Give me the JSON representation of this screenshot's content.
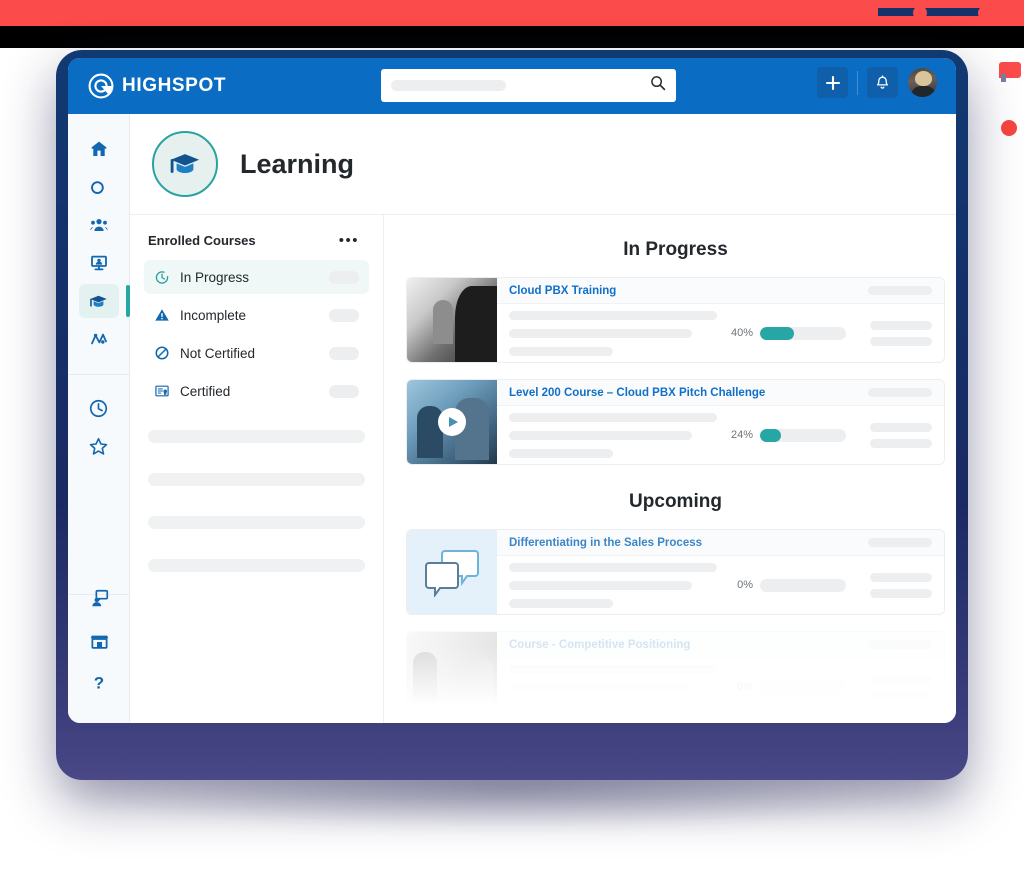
{
  "topnav": {
    "brand": "HIGHSPOT",
    "brand_logo_name": "highspot-logo",
    "search_placeholder": "",
    "search_value": "",
    "add_label": "+",
    "accent_blue": "#0b6cc4"
  },
  "page": {
    "title": "Learning",
    "badge_icon": "graduation-cap-icon",
    "accent_teal": "#26a7a5"
  },
  "rail": {
    "items": [
      {
        "name": "home",
        "icon": "home-icon"
      },
      {
        "name": "spots",
        "icon": "spots-icon"
      },
      {
        "name": "people",
        "icon": "people-icon"
      },
      {
        "name": "pitch",
        "icon": "presentation-icon"
      },
      {
        "name": "learning",
        "icon": "graduation-cap-icon",
        "active": true
      },
      {
        "name": "analytics",
        "icon": "analytics-icon"
      },
      {
        "name": "recent",
        "icon": "clock-icon"
      },
      {
        "name": "bookmarks",
        "icon": "star-icon"
      }
    ],
    "bottom_items": [
      {
        "name": "feedback",
        "icon": "feedback-icon"
      },
      {
        "name": "marketplace",
        "icon": "store-icon"
      },
      {
        "name": "help",
        "icon": "question-mark-icon"
      }
    ]
  },
  "left_pane": {
    "title": "Enrolled Courses",
    "menu_label": "•••",
    "filters": [
      {
        "label": "In Progress",
        "icon": "clock-progress-icon",
        "active": true
      },
      {
        "label": "Incomplete",
        "icon": "warning-triangle-icon",
        "active": false
      },
      {
        "label": "Not Certified",
        "icon": "no-entry-icon",
        "active": false
      },
      {
        "label": "Certified",
        "icon": "certificate-icon",
        "active": false
      }
    ]
  },
  "sections": [
    {
      "title": "In Progress",
      "cards": [
        {
          "title": "Cloud PBX Training",
          "progress_label": "40%",
          "progress_value": 40,
          "thumb": "photo-presentation",
          "has_play": false,
          "faded": false
        },
        {
          "title": "Level 200 Course – Cloud PBX Pitch Challenge",
          "progress_label": "24%",
          "progress_value": 24,
          "thumb": "photo-video-meeting",
          "has_play": true,
          "faded": false
        }
      ]
    },
    {
      "title": "Upcoming",
      "cards": [
        {
          "title": "Differentiating in the Sales Process",
          "progress_label": "0%",
          "progress_value": 0,
          "thumb": "speech-bubbles",
          "has_play": false,
          "faded": false
        },
        {
          "title": "Course - Competitive Positioning",
          "progress_label": "0%",
          "progress_value": 0,
          "thumb": "photo-handshake",
          "has_play": false,
          "faded": true
        }
      ]
    }
  ]
}
